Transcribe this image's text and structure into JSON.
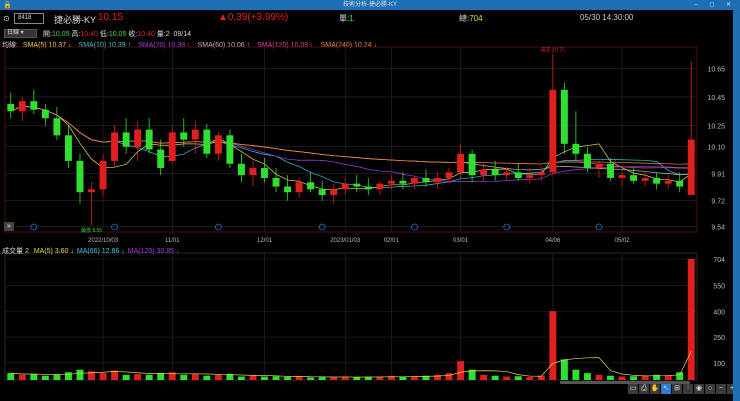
{
  "window": {
    "title": "技術分析-捷必勝-KY",
    "controls": "–  ◻  ✕"
  },
  "quote": {
    "code": "8418",
    "name": "捷必勝-KY",
    "price": "10.15",
    "change": "▲0.39(+3.99%)",
    "single_label": "單:",
    "single_value": "1",
    "total_label": "總:",
    "total_value": "704",
    "datetime": "05/30 14:30:00"
  },
  "bar_info": {
    "period": "日線",
    "open_label": "開:",
    "open": "10.05",
    "high_label": "高:",
    "high": "10.40",
    "low_label": "低:",
    "low": "10.05",
    "close_label": "收:",
    "close": "10.40",
    "vol_label": "量:",
    "vol": "2",
    "date": "09/14"
  },
  "ma_legend": {
    "label": "均線:",
    "items": [
      {
        "text": "SMA(5) 10.37 ↓",
        "color": "#e8d84a"
      },
      {
        "text": "SMA(10) 10.39 ↑",
        "color": "#35c8e0"
      },
      {
        "text": "SMA(20) 10.38 ↑",
        "color": "#a040e0"
      },
      {
        "text": "SMA(60) 10.06 ↑",
        "color": "#bbbbbb"
      },
      {
        "text": "SMA(120) 10.09 ↓",
        "color": "#e040a0"
      },
      {
        "text": "SMA(240) 10.24 ↓",
        "color": "#e88a2a"
      }
    ]
  },
  "vol_legend": {
    "label": "成交量",
    "value": "2",
    "items": [
      {
        "text": "MA(5) 3.60 ↓",
        "color": "#e8d84a"
      },
      {
        "text": "MA(66) 12.86 ↓",
        "color": "#35c8e0"
      },
      {
        "text": "MA(120) 30.85 ↓",
        "color": "#a040e0"
      }
    ]
  },
  "toolbar": [
    "▭",
    "⎙",
    "✋",
    "↖",
    "⊞",
    "⫶",
    "◉",
    "○",
    "−",
    "+"
  ],
  "colors": {
    "up": "#e02020",
    "down": "#30e030",
    "grid": "#2a2a2a",
    "axis_border": "#6a1020"
  },
  "chart_data": {
    "type": "candlestick",
    "price_ticks": [
      "10.65",
      "10.45",
      "10.25",
      "10.10",
      "9.91",
      "9.72",
      "9.54"
    ],
    "price_tick_values": [
      10.65,
      10.45,
      10.25,
      10.1,
      9.91,
      9.72,
      9.54
    ],
    "ylim": [
      9.5,
      10.78
    ],
    "high_annotation": "最高 10.75",
    "low_annotation": "最低 9.55",
    "date_ticks": [
      {
        "i": 8,
        "label": "2022/10/03"
      },
      {
        "i": 14,
        "label": "11/01"
      },
      {
        "i": 22,
        "label": "12/01"
      },
      {
        "i": 29,
        "label": "2023/01/03"
      },
      {
        "i": 33,
        "label": "02/01"
      },
      {
        "i": 39,
        "label": "03/01"
      },
      {
        "i": 47,
        "label": "04/06"
      },
      {
        "i": 53,
        "label": "05/02"
      }
    ],
    "ohlc": [
      [
        10.4,
        10.48,
        10.3,
        10.35
      ],
      [
        10.35,
        10.45,
        10.28,
        10.42
      ],
      [
        10.42,
        10.5,
        10.33,
        10.36
      ],
      [
        10.36,
        10.4,
        10.25,
        10.3
      ],
      [
        10.3,
        10.38,
        10.15,
        10.18
      ],
      [
        10.18,
        10.25,
        9.95,
        10.0
      ],
      [
        10.0,
        10.05,
        9.7,
        9.78
      ],
      [
        9.78,
        9.85,
        9.55,
        9.8
      ],
      [
        9.8,
        10.05,
        9.75,
        10.0
      ],
      [
        10.0,
        10.25,
        9.95,
        10.2
      ],
      [
        10.2,
        10.3,
        10.05,
        10.1
      ],
      [
        10.1,
        10.28,
        10.0,
        10.22
      ],
      [
        10.22,
        10.3,
        10.05,
        10.08
      ],
      [
        10.08,
        10.15,
        9.9,
        9.95
      ],
      [
        10.0,
        10.25,
        9.98,
        10.2
      ],
      [
        10.2,
        10.3,
        10.1,
        10.15
      ],
      [
        10.15,
        10.28,
        10.05,
        10.22
      ],
      [
        10.22,
        10.26,
        10.02,
        10.05
      ],
      [
        10.05,
        10.2,
        10.0,
        10.18
      ],
      [
        10.18,
        10.22,
        9.95,
        9.98
      ],
      [
        9.98,
        10.05,
        9.85,
        9.9
      ],
      [
        9.9,
        10.0,
        9.82,
        9.95
      ],
      [
        9.95,
        10.02,
        9.85,
        9.88
      ],
      [
        9.88,
        9.95,
        9.78,
        9.82
      ],
      [
        9.82,
        9.9,
        9.72,
        9.78
      ],
      [
        9.78,
        9.88,
        9.74,
        9.85
      ],
      [
        9.85,
        9.92,
        9.78,
        9.8
      ],
      [
        9.8,
        9.86,
        9.72,
        9.76
      ],
      [
        9.76,
        9.84,
        9.7,
        9.8
      ],
      [
        9.8,
        9.88,
        9.76,
        9.84
      ],
      [
        9.84,
        9.9,
        9.78,
        9.82
      ],
      [
        9.82,
        9.88,
        9.76,
        9.8
      ],
      [
        9.8,
        9.86,
        9.76,
        9.84
      ],
      [
        9.84,
        9.9,
        9.8,
        9.86
      ],
      [
        9.86,
        9.92,
        9.8,
        9.84
      ],
      [
        9.84,
        9.9,
        9.8,
        9.88
      ],
      [
        9.88,
        9.94,
        9.82,
        9.85
      ],
      [
        9.85,
        9.92,
        9.8,
        9.88
      ],
      [
        9.88,
        9.95,
        9.84,
        9.92
      ],
      [
        9.92,
        10.12,
        9.88,
        10.05
      ],
      [
        10.05,
        10.08,
        9.85,
        9.9
      ],
      [
        9.9,
        9.98,
        9.85,
        9.94
      ],
      [
        9.94,
        10.0,
        9.86,
        9.9
      ],
      [
        9.9,
        9.96,
        9.86,
        9.92
      ],
      [
        9.92,
        9.98,
        9.86,
        9.88
      ],
      [
        9.88,
        9.95,
        9.84,
        9.9
      ],
      [
        9.9,
        9.96,
        9.86,
        9.92
      ],
      [
        9.92,
        10.75,
        9.9,
        10.5
      ],
      [
        10.5,
        10.55,
        10.05,
        10.12
      ],
      [
        10.12,
        10.35,
        10.0,
        10.05
      ],
      [
        10.05,
        10.1,
        9.92,
        9.95
      ],
      [
        9.95,
        10.0,
        9.88,
        9.98
      ],
      [
        9.98,
        10.02,
        9.86,
        9.88
      ],
      [
        9.88,
        9.94,
        9.82,
        9.9
      ],
      [
        9.9,
        9.95,
        9.84,
        9.86
      ],
      [
        9.86,
        9.92,
        9.82,
        9.88
      ],
      [
        9.88,
        9.92,
        9.8,
        9.84
      ],
      [
        9.84,
        9.9,
        9.8,
        9.86
      ],
      [
        9.86,
        9.92,
        9.78,
        9.82
      ],
      [
        9.76,
        10.7,
        9.76,
        10.15
      ]
    ],
    "volume": [
      40,
      30,
      35,
      25,
      30,
      45,
      60,
      50,
      40,
      55,
      30,
      35,
      30,
      40,
      45,
      30,
      35,
      25,
      30,
      35,
      20,
      25,
      20,
      22,
      18,
      20,
      15,
      18,
      16,
      20,
      15,
      18,
      20,
      22,
      18,
      20,
      25,
      30,
      40,
      110,
      60,
      30,
      25,
      20,
      22,
      18,
      25,
      400,
      120,
      60,
      40,
      30,
      25,
      20,
      22,
      25,
      30,
      28,
      45,
      704
    ],
    "volume_ticks": [
      "704",
      "550",
      "400",
      "250",
      "100"
    ],
    "volume_tick_values": [
      704,
      550,
      400,
      250,
      100
    ],
    "volume_ylim": [
      0,
      704
    ]
  }
}
